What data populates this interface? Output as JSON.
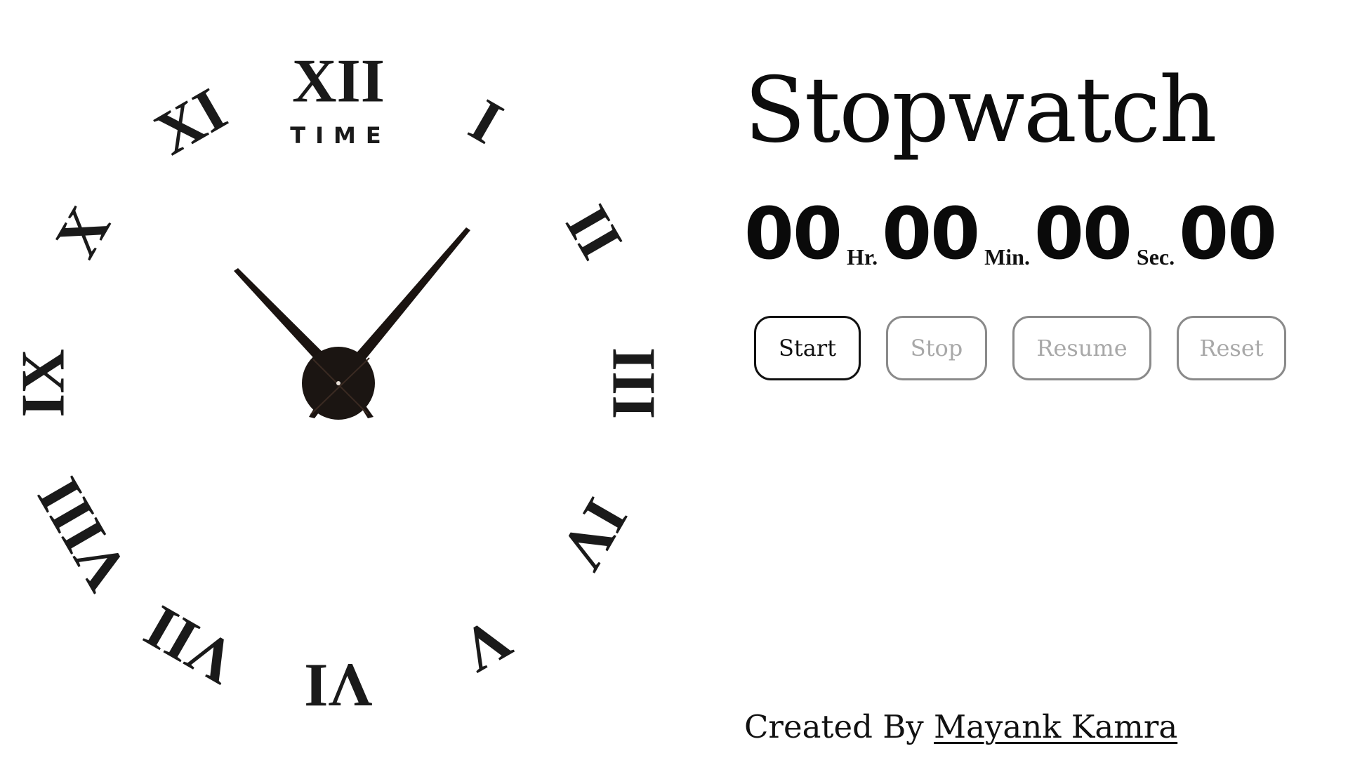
{
  "clock": {
    "brand_label": "TIME",
    "numerals": [
      "XII",
      "I",
      "II",
      "III",
      "IV",
      "V",
      "VI",
      "VII",
      "VIII",
      "IX",
      "X",
      "XI"
    ],
    "hand_color": "#1a1310"
  },
  "stopwatch": {
    "title": "Stopwatch",
    "hours": "00",
    "hours_unit": "Hr.",
    "minutes": "00",
    "minutes_unit": "Min.",
    "seconds": "00",
    "seconds_unit": "Sec.",
    "centiseconds": "00"
  },
  "controls": {
    "start_label": "Start",
    "stop_label": "Stop",
    "resume_label": "Resume",
    "reset_label": "Reset"
  },
  "footer": {
    "credit_prefix": "Created By",
    "author_name": "Mayank Kamra"
  },
  "colors": {
    "text": "#111111",
    "disabled_border": "#8a8a8a",
    "disabled_text": "#a8a8a8",
    "background": "#ffffff"
  }
}
